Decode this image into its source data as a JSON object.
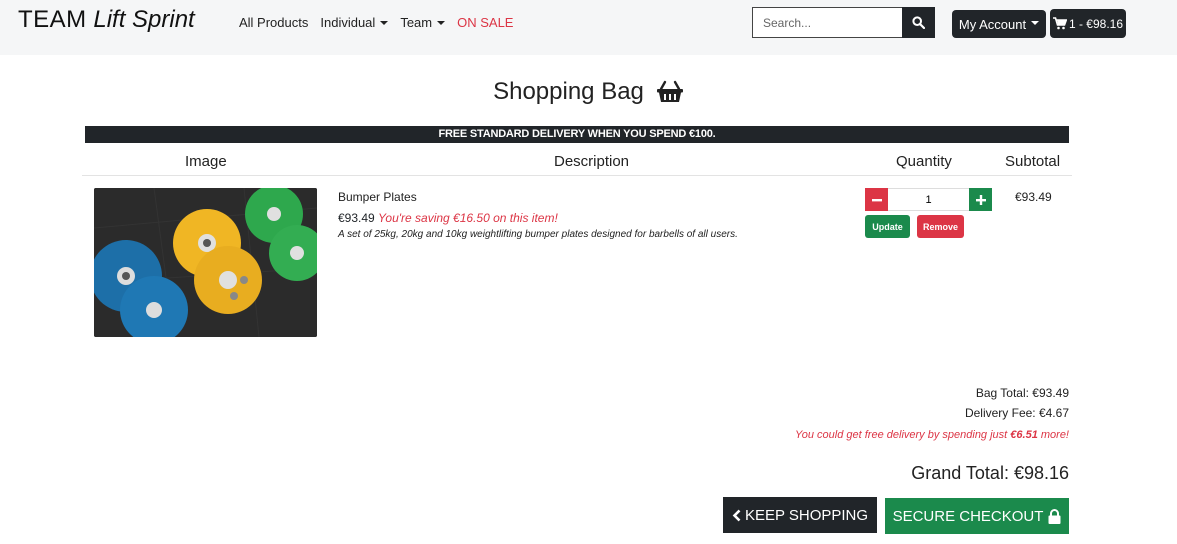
{
  "header": {
    "brand_main": "TEAM",
    "brand_sub": "Lift Sprint",
    "nav": [
      {
        "label": "All Products"
      },
      {
        "label": "Individual"
      },
      {
        "label": "Team"
      },
      {
        "label": "ON SALE"
      }
    ],
    "search_placeholder": "Search...",
    "account_label": "My Account",
    "cart_label": "1 - €98.16"
  },
  "page": {
    "title": "Shopping Bag",
    "banner": "FREE STANDARD DELIVERY WHEN YOU SPEND €100."
  },
  "table": {
    "headers": {
      "image": "Image",
      "description": "Description",
      "quantity": "Quantity",
      "subtotal": "Subtotal"
    },
    "item": {
      "name": "Bumper Plates",
      "price": "€93.49",
      "saving": "You're saving €16.50 on this item!",
      "description": "A set of 25kg, 20kg and 10kg weightlifting bumper plates designed for barbells of all users.",
      "quantity": "1",
      "update_label": "Update",
      "remove_label": "Remove",
      "subtotal": "€93.49"
    }
  },
  "totals": {
    "bag_total": "Bag Total: €93.49",
    "delivery_fee": "Delivery Fee: €4.67",
    "free_prefix": "You could get free delivery by spending just ",
    "free_amount": "€6.51",
    "free_suffix": " more!",
    "grand_total": "Grand Total: €98.16"
  },
  "actions": {
    "keep_shopping": "KEEP SHOPPING",
    "secure_checkout": "SECURE CHECKOUT"
  },
  "colors": {
    "dark": "#212529",
    "green": "#1b8a4c",
    "red": "#dc3545"
  }
}
